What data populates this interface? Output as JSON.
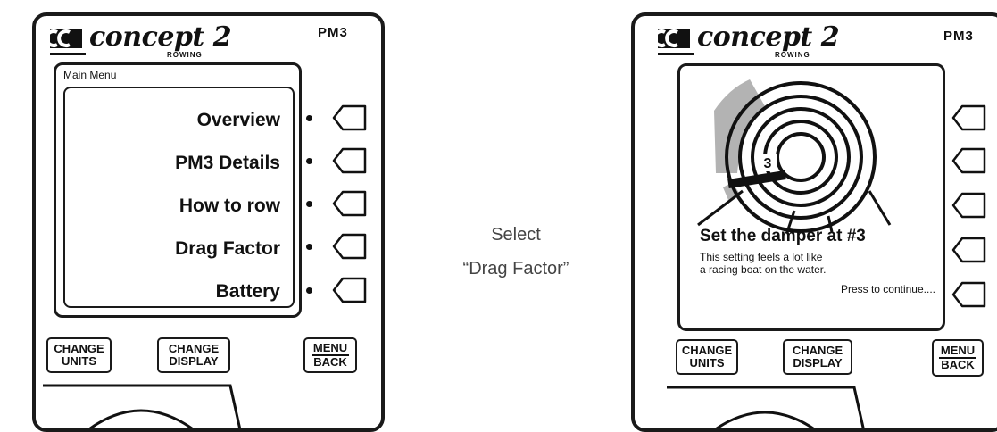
{
  "colors": {
    "ink": "#1a1a1a",
    "caption": "#444444",
    "damper_highlight": "#b3b3b3"
  },
  "left_monitor": {
    "brand": "concept 2",
    "brand_sub": "ROWING",
    "model": "PM3",
    "menu_title": "Main Menu",
    "menu_items": [
      {
        "label": "Overview"
      },
      {
        "label": "PM3 Details"
      },
      {
        "label": "How to row"
      },
      {
        "label": "Drag Factor"
      },
      {
        "label": "Battery"
      }
    ],
    "buttons": {
      "change_units": [
        "CHANGE",
        "UNITS"
      ],
      "change_display": [
        "CHANGE",
        "DISPLAY"
      ],
      "menu_back": [
        "MENU",
        "BACK"
      ]
    }
  },
  "caption": {
    "line1": "Select",
    "line2": "“Drag Factor”"
  },
  "right_monitor": {
    "brand": "concept 2",
    "brand_sub": "ROWING",
    "model": "PM3",
    "damper_number": "3",
    "damper_title": "Set the damper at #3",
    "damper_desc_1": "This setting feels a lot like",
    "damper_desc_2": "a racing boat on the water.",
    "continue_text": "Press to continue....",
    "buttons": {
      "change_units": [
        "CHANGE",
        "UNITS"
      ],
      "change_display": [
        "CHANGE",
        "DISPLAY"
      ],
      "menu_back": [
        "MENU",
        "BACK"
      ]
    }
  }
}
